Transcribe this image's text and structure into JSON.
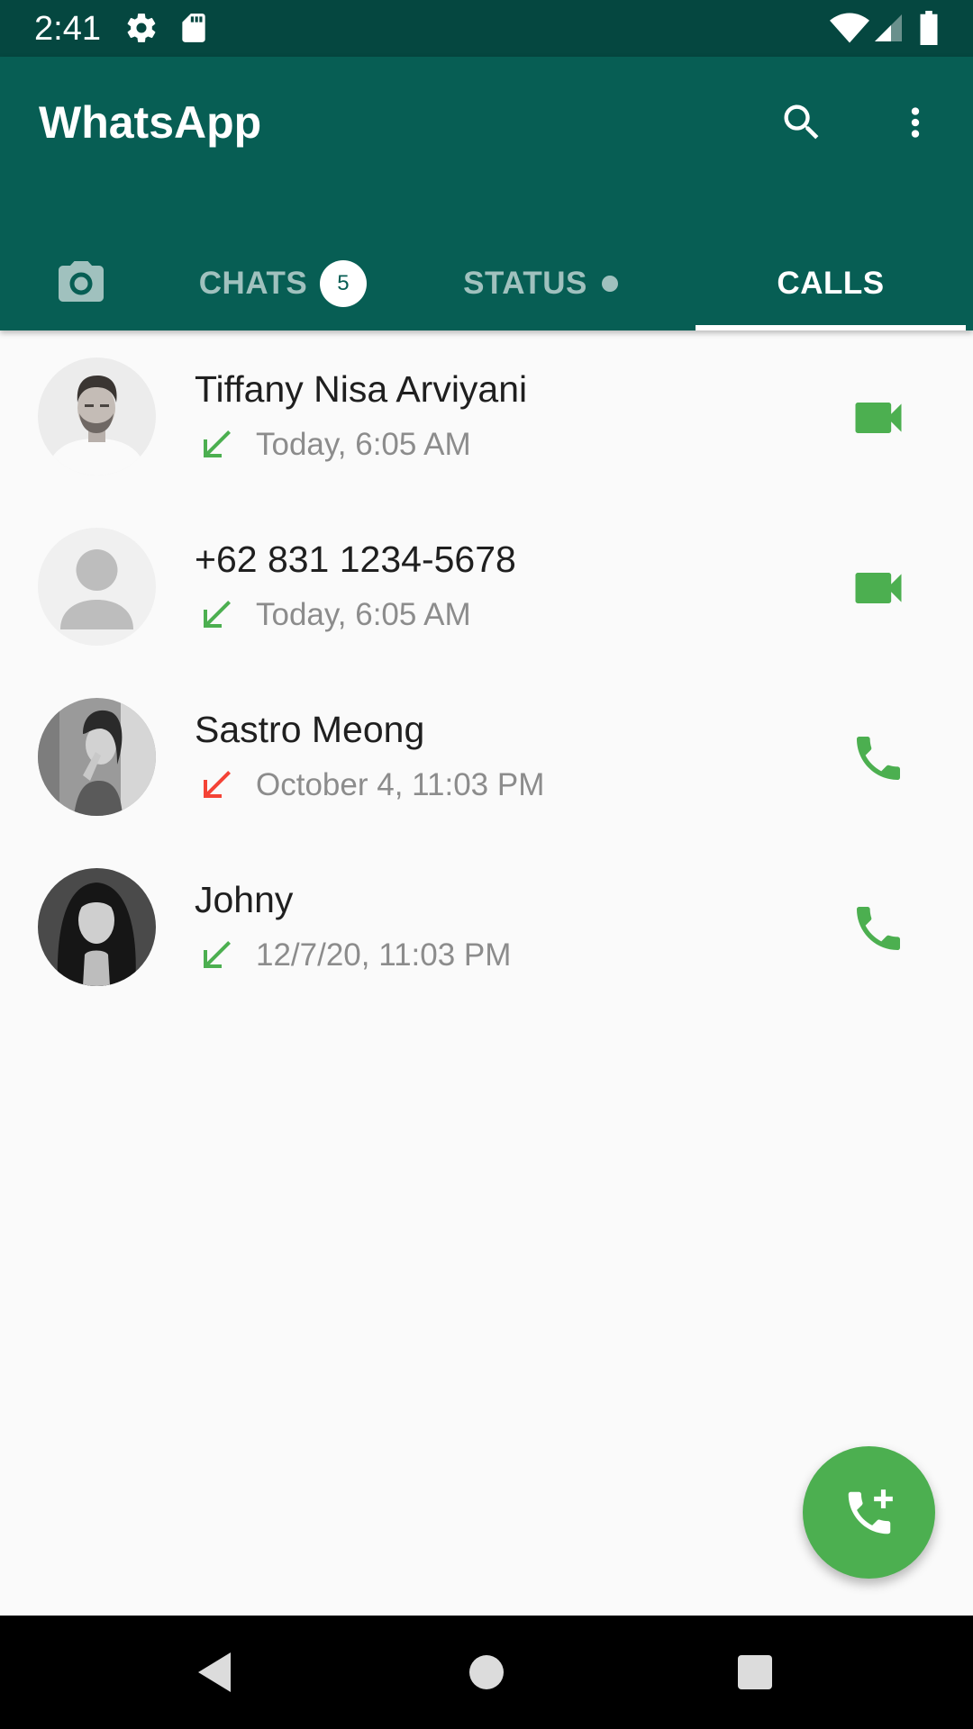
{
  "status_bar": {
    "time": "2:41",
    "left_icons": [
      "settings-gear-icon",
      "sd-card-icon"
    ],
    "right_icons": [
      "wifi-icon",
      "cell-signal-icon",
      "battery-icon"
    ]
  },
  "app_bar": {
    "title": "WhatsApp",
    "actions": [
      "search-icon",
      "more-vert-icon"
    ]
  },
  "tabs": [
    {
      "label": "",
      "icon": "camera-icon"
    },
    {
      "label": "CHATS",
      "badge": "5"
    },
    {
      "label": "STATUS",
      "dot": true
    },
    {
      "label": "CALLS",
      "active": true
    }
  ],
  "calls": [
    {
      "name": "Tiffany Nisa Arviyani",
      "time": "Today, 6:05 AM",
      "direction": "incoming",
      "status": "received",
      "type": "video"
    },
    {
      "name": "+62 831 1234-5678",
      "time": "Today, 6:05 AM",
      "direction": "incoming",
      "status": "received",
      "type": "video"
    },
    {
      "name": "Sastro Meong",
      "time": "October 4, 11:03 PM",
      "direction": "incoming",
      "status": "missed",
      "type": "voice"
    },
    {
      "name": "Johny",
      "time": "12/7/20, 11:03 PM",
      "direction": "incoming",
      "status": "received",
      "type": "voice"
    }
  ],
  "fab": {
    "icon": "add-call-icon"
  },
  "colors": {
    "status_bar": "#054740",
    "app_bar": "#075e54",
    "accent": "#4caf50",
    "missed": "#f44336",
    "secondary_text": "#8c8c8c"
  }
}
